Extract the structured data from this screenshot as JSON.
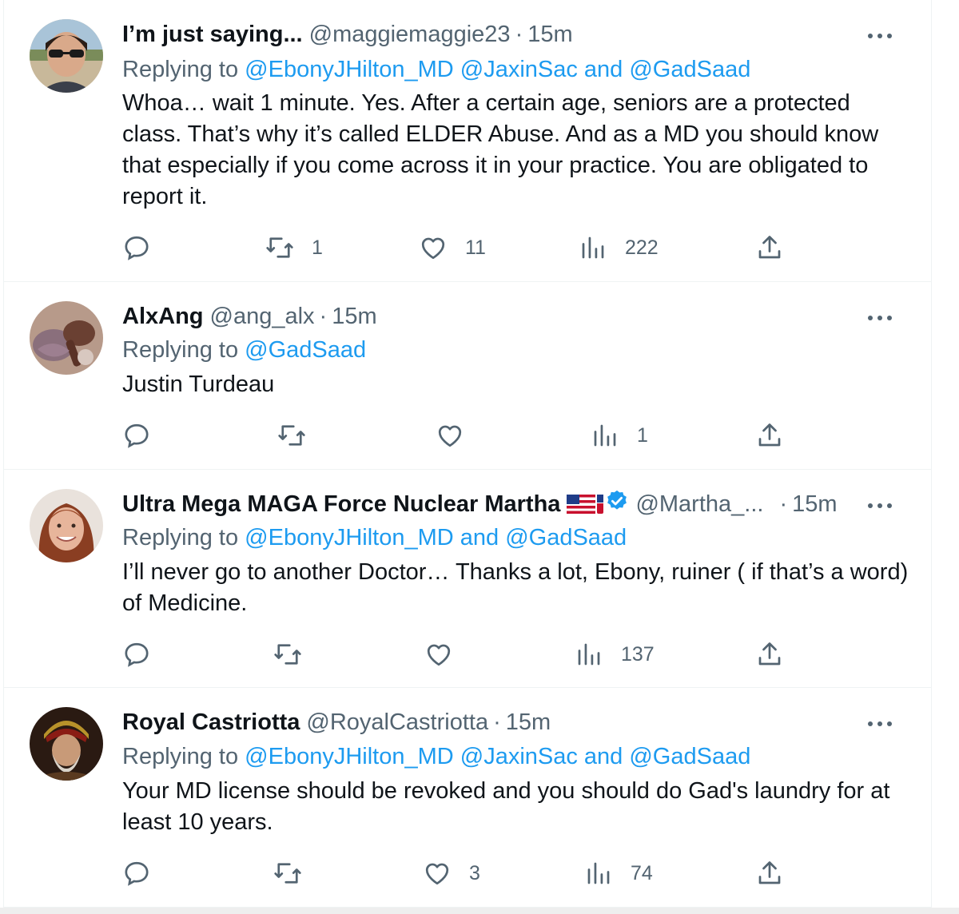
{
  "tweets": [
    {
      "name": "I’m just saying...",
      "handle": "@maggiemaggie23",
      "sep": "·",
      "time": "15m",
      "replying_label": "Replying to",
      "mentions": "@EbonyJHilton_MD @JaxinSac and @GadSaad",
      "text": "Whoa… wait 1 minute. Yes. After a certain age, seniors are a protected class. That’s why it’s called ELDER Abuse. And as a MD you should know that especially if you come across it in your practice. You are obligated to report it.",
      "retweets": "1",
      "likes": "11",
      "views": "222"
    },
    {
      "name": "AlxAng",
      "handle": "@ang_alx",
      "sep": "·",
      "time": "15m",
      "replying_label": "Replying to",
      "mentions": "@GadSaad",
      "text": "Justin Turdeau",
      "retweets": "",
      "likes": "",
      "views": "1"
    },
    {
      "name": "Ultra Mega MAGA Force Nuclear Martha",
      "handle": "@Martha_...",
      "sep": "·",
      "time": "15m",
      "replying_label": "Replying to",
      "mentions": "@EbonyJHilton_MD and @GadSaad",
      "text": "I’ll never go to another Doctor… Thanks a lot, Ebony, ruiner ( if that’s a word) of Medicine.",
      "retweets": "",
      "likes": "",
      "views": "137"
    },
    {
      "name": "Royal Castriotta",
      "handle": "@RoyalCastriotta",
      "sep": "·",
      "time": "15m",
      "replying_label": "Replying to",
      "mentions": "@EbonyJHilton_MD @JaxinSac and @GadSaad",
      "text": "Your MD license should be revoked and you should do Gad's laundry for at least 10 years.",
      "retweets": "",
      "likes": "3",
      "views": "74"
    }
  ],
  "icons": {
    "reply": "reply-icon",
    "retweet": "retweet-icon",
    "like": "heart-icon",
    "views": "views-icon",
    "share": "share-icon",
    "more": "more-icon",
    "verified": "verified-badge-icon",
    "flag": "us-flag-icon"
  },
  "colors": {
    "link": "#1d9bf0",
    "secondary_text": "#536471",
    "primary_text": "#0f1419",
    "divider": "#eff3f4"
  }
}
